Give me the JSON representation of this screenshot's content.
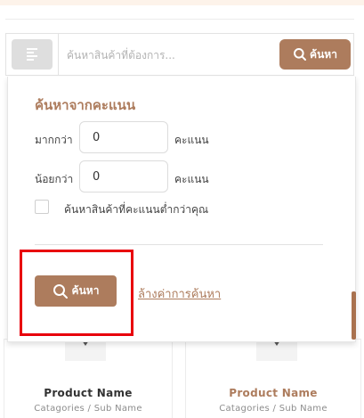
{
  "header": {
    "filter_toggle_icon": "lines-icon",
    "search_placeholder": "ค้นหาสินค้าที่ต้องการ...",
    "search_button_label": "ค้นหา",
    "search_button_icon": "search-icon"
  },
  "filter_panel": {
    "title": "ค้นหาจากคะแนน",
    "min_label": "มากกว่า",
    "min_value": "0",
    "max_label": "น้อยกว่า",
    "max_value": "0",
    "unit": "คะแนน",
    "checkbox_label": "ค้นหาสินค้าที่คะแนนต่ำกว่าคุณ",
    "checkbox_checked": false,
    "apply_label": "ค้นหา",
    "apply_icon": "search-icon",
    "reset_label": "ล้างค่าการค้นหา"
  },
  "products": [
    {
      "name": "Product Name",
      "category": "Catagories / Sub Name"
    },
    {
      "name": "Product Name",
      "category": "Catagories / Sub Name"
    }
  ],
  "colors": {
    "accent": "#ad7c5d",
    "highlight": "#e8000b",
    "toggle_bg": "#dedede"
  }
}
